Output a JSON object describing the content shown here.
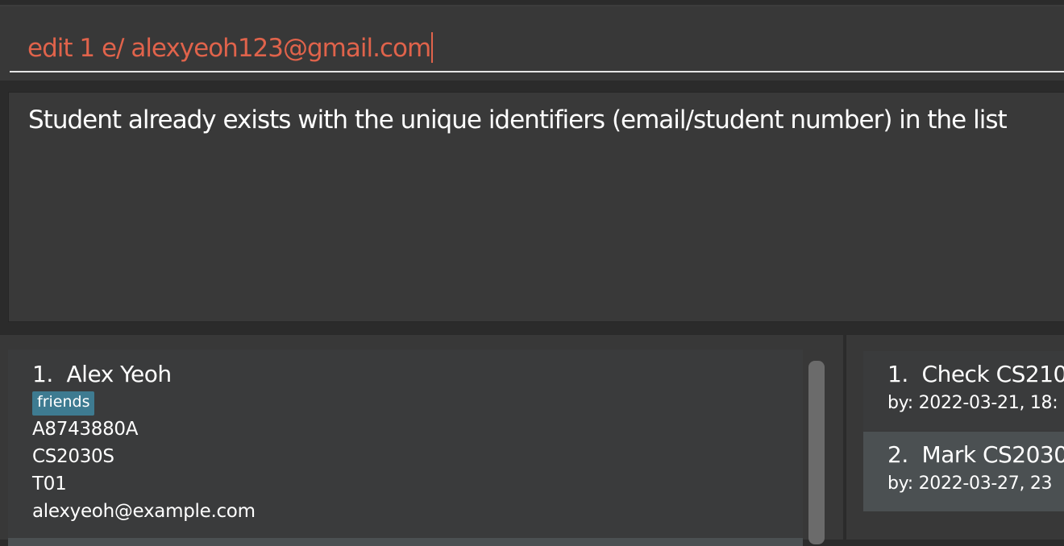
{
  "command": {
    "value": "edit 1 e/ alexyeoh123@gmail.com"
  },
  "result": {
    "message": "Student already exists with the unique identifiers (email/student number) in the list"
  },
  "students": [
    {
      "index": "1.",
      "name": "Alex Yeoh",
      "tags": [
        "friends"
      ],
      "student_id": "A8743880A",
      "module": "CS2030S",
      "tutorial": "T01",
      "email": "alexyeoh@example.com"
    }
  ],
  "tasks": [
    {
      "index": "1.",
      "title": "Check CS210",
      "due": "by: 2022-03-21, 18:"
    },
    {
      "index": "2.",
      "title": "Mark CS2030",
      "due": "by: 2022-03-27, 23"
    }
  ]
}
